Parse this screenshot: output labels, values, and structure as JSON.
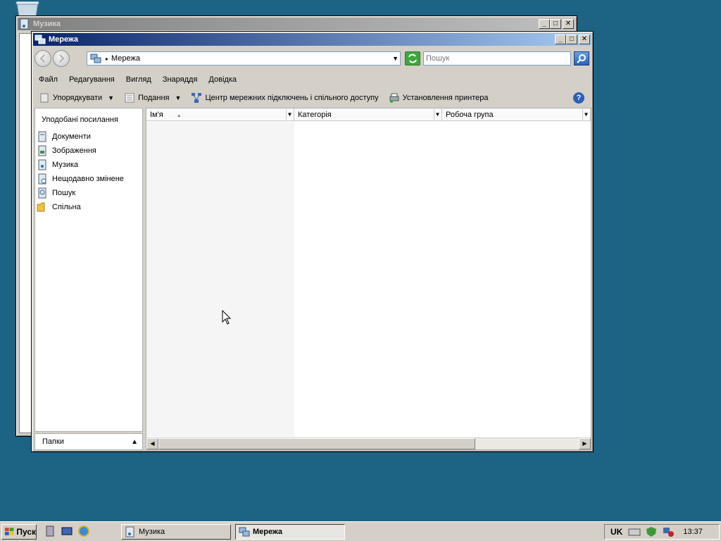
{
  "music_window": {
    "title": "Музика",
    "controls": {
      "minimize": "_",
      "maximize": "□",
      "close": "✕"
    }
  },
  "network_window": {
    "title": "Мережа",
    "controls": {
      "minimize": "_",
      "maximize": "□",
      "close": "✕"
    },
    "address": {
      "path": "Мережа",
      "icon": "network-icon"
    },
    "search": {
      "placeholder": "Пошук"
    },
    "menu": [
      "Файл",
      "Редагування",
      "Вигляд",
      "Знаряддя",
      "Довідка"
    ],
    "toolbar": {
      "organize": "Упорядкувати",
      "views": "Подання",
      "network_center": "Центр мережних підключень і спільного доступу",
      "add_printer": "Установлення принтера",
      "help": "?"
    },
    "sidebar": {
      "title": "Уподобані посилання",
      "items": [
        {
          "label": "Документи",
          "icon": "documents-icon"
        },
        {
          "label": "Зображення",
          "icon": "pictures-icon"
        },
        {
          "label": "Музика",
          "icon": "music-icon"
        },
        {
          "label": "Нещодавно змінене",
          "icon": "recent-icon"
        },
        {
          "label": "Пошук",
          "icon": "search-icon"
        },
        {
          "label": "Спільна",
          "icon": "folder-icon"
        }
      ],
      "folders_label": "Папки"
    },
    "columns": [
      "Ім'я",
      "Категорія",
      "Робоча група"
    ]
  },
  "taskbar": {
    "start_label": "Пуск",
    "tasks": [
      {
        "label": "Музика",
        "active": false
      },
      {
        "label": "Мережа",
        "active": true
      }
    ],
    "language": "UK",
    "clock": "13:37"
  },
  "colors": {
    "desktop": "#1d6384",
    "active_title": "#0a246a",
    "inactive_title": "#808080"
  }
}
